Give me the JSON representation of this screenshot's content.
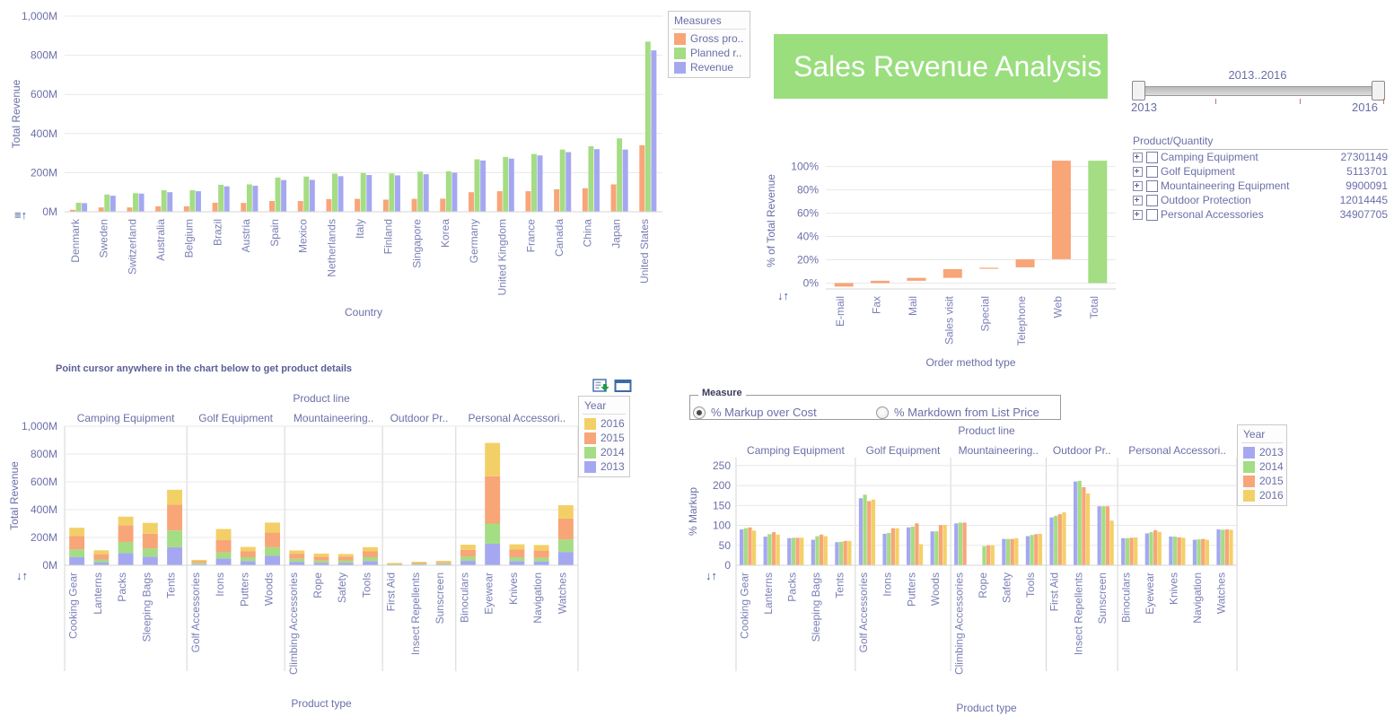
{
  "title_banner": {
    "text": "Sales Revenue Analysis",
    "bg": "#9ade7e",
    "fg": "#ffffff"
  },
  "year_slider": {
    "caption": "2013..2016",
    "min_label": "2013",
    "max_label": "2016"
  },
  "product_quantity": {
    "title": "Product/Quantity",
    "rows": [
      {
        "name": "Camping Equipment",
        "value": "27301149"
      },
      {
        "name": "Golf Equipment",
        "value": "5113701"
      },
      {
        "name": "Mountaineering Equipment",
        "value": "9900091"
      },
      {
        "name": "Outdoor Protection",
        "value": "12014445"
      },
      {
        "name": "Personal Accessories",
        "value": "34907705"
      }
    ]
  },
  "hint": {
    "text": "Point cursor anywhere in the chart below to get product details"
  },
  "measure": {
    "legend": "Measure",
    "options": [
      {
        "label": "% Markup over Cost",
        "selected": true
      },
      {
        "label": "% Markdown from List Price",
        "selected": false
      }
    ]
  },
  "toolbar": {
    "export_icon": "export-icon",
    "window_icon": "window-icon",
    "sort_icon": "sort-icon"
  },
  "colors": {
    "orange": "#f8a578",
    "green": "#a4dd83",
    "purple": "#a5a8f0",
    "yellow": "#f3d067",
    "axis_text": "#6b6fa8",
    "grid": "#e8e8e8"
  },
  "chart_data": [
    {
      "id": "revenue-by-country",
      "type": "bar",
      "title": "",
      "xlabel": "Country",
      "ylabel": "Total Revenue",
      "ylim": [
        0,
        1000
      ],
      "yticks": [
        "0M",
        "200M",
        "400M",
        "600M",
        "800M",
        "1,000M"
      ],
      "legend_title": "Measures",
      "legend_position": "top-right",
      "grid": true,
      "categories": [
        "Denmark",
        "Sweden",
        "Switzerland",
        "Australia",
        "Belgium",
        "Brazil",
        "Austria",
        "Spain",
        "Mexico",
        "Netherlands",
        "Italy",
        "Finland",
        "Singapore",
        "Korea",
        "Germany",
        "United Kingdom",
        "France",
        "Canada",
        "China",
        "Japan",
        "United States"
      ],
      "series": [
        {
          "name": "Gross pro..",
          "color": "#f8a578",
          "values": [
            10,
            22,
            22,
            28,
            28,
            46,
            45,
            55,
            55,
            65,
            66,
            62,
            66,
            67,
            100,
            105,
            105,
            115,
            120,
            140,
            340
          ]
        },
        {
          "name": "Planned r..",
          "color": "#a4dd83",
          "values": [
            46,
            88,
            95,
            110,
            110,
            138,
            140,
            175,
            180,
            195,
            198,
            196,
            205,
            207,
            268,
            280,
            295,
            318,
            335,
            375,
            870
          ]
        },
        {
          "name": "Revenue",
          "color": "#a5a8f0",
          "values": [
            44,
            82,
            93,
            100,
            105,
            130,
            133,
            162,
            163,
            182,
            188,
            186,
            192,
            200,
            262,
            272,
            288,
            305,
            320,
            318,
            825
          ]
        }
      ]
    },
    {
      "id": "revenue-by-order-method",
      "type": "bar",
      "subtype": "waterfall",
      "title": "",
      "xlabel": "Order method type",
      "ylabel": "% of Total Revenue",
      "ylim": [
        -5,
        108
      ],
      "yticks": [
        "0%",
        "20%",
        "40%",
        "60%",
        "80%",
        "100%"
      ],
      "grid": true,
      "categories": [
        "E-mail",
        "Fax",
        "Mail",
        "Sales visit",
        "Special",
        "Telephone",
        "Web",
        "Total"
      ],
      "bars": [
        {
          "category": "E-mail",
          "base": -3.0,
          "top": 0.0,
          "color": "#f8a578"
        },
        {
          "category": "Fax",
          "base": 0.0,
          "top": 2.0,
          "color": "#f8a578"
        },
        {
          "category": "Mail",
          "base": 2.0,
          "top": 4.5,
          "color": "#f8a578"
        },
        {
          "category": "Sales visit",
          "base": 4.5,
          "top": 12.0,
          "color": "#f8a578"
        },
        {
          "category": "Special",
          "base": 12.0,
          "top": 13.5,
          "color": "#f8c9a8"
        },
        {
          "category": "Telephone",
          "base": 13.5,
          "top": 20.5,
          "color": "#f8a578"
        },
        {
          "category": "Web",
          "base": 20.5,
          "top": 105.0,
          "color": "#f8a578"
        },
        {
          "category": "Total",
          "base": 0.0,
          "top": 105.0,
          "color": "#a4dd83"
        }
      ]
    },
    {
      "id": "revenue-by-product-type",
      "type": "bar",
      "subtype": "stacked",
      "title": "",
      "xlabel": "Product type",
      "ylabel": "Total Revenue",
      "group_axis_label": "Product line",
      "ylim": [
        0,
        1000
      ],
      "yticks": [
        "0M",
        "200M",
        "400M",
        "600M",
        "800M",
        "1,000M"
      ],
      "legend_title": "Year",
      "grid": true,
      "groups": [
        {
          "label": "Camping Equipment",
          "types": [
            "Cooking Gear",
            "Lanterns",
            "Packs",
            "Sleeping Bags",
            "Tents"
          ]
        },
        {
          "label": "Golf Equipment",
          "types": [
            "Golf Accessories",
            "Irons",
            "Putters",
            "Woods"
          ]
        },
        {
          "label": "Mountaineering..",
          "types": [
            "Climbing Accessories",
            "Rope",
            "Safety",
            "Tools"
          ]
        },
        {
          "label": "Outdoor Pr..",
          "types": [
            "First Aid",
            "Insect Repellents",
            "Sunscreen"
          ]
        },
        {
          "label": "Personal Accessori..",
          "types": [
            "Binoculars",
            "Eyewear",
            "Knives",
            "Navigation",
            "Watches"
          ]
        }
      ],
      "categories": [
        "Cooking Gear",
        "Lanterns",
        "Packs",
        "Sleeping Bags",
        "Tents",
        "Golf Accessories",
        "Irons",
        "Putters",
        "Woods",
        "Climbing Accessories",
        "Rope",
        "Safety",
        "Tools",
        "First Aid",
        "Insect Repellents",
        "Sunscreen",
        "Binoculars",
        "Eyewear",
        "Knives",
        "Navigation",
        "Watches"
      ],
      "series": [
        {
          "name": "2013",
          "color": "#a5a8f0",
          "values": [
            60,
            22,
            88,
            62,
            130,
            8,
            48,
            30,
            68,
            25,
            18,
            18,
            30,
            4,
            6,
            8,
            32,
            155,
            30,
            28,
            96
          ]
        },
        {
          "name": "2014",
          "color": "#a4dd83",
          "values": [
            55,
            20,
            80,
            60,
            120,
            9,
            45,
            28,
            62,
            22,
            16,
            17,
            28,
            4,
            6,
            7,
            30,
            145,
            28,
            26,
            90
          ]
        },
        {
          "name": "2015",
          "color": "#f8a578",
          "values": [
            95,
            38,
            120,
            105,
            185,
            12,
            90,
            42,
            105,
            36,
            28,
            26,
            42,
            5,
            7,
            9,
            48,
            340,
            55,
            52,
            150
          ]
        },
        {
          "name": "2016",
          "color": "#f3d067",
          "values": [
            60,
            28,
            62,
            78,
            108,
            10,
            78,
            32,
            72,
            24,
            22,
            20,
            30,
            4,
            6,
            8,
            38,
            240,
            38,
            40,
            96
          ]
        }
      ]
    },
    {
      "id": "markup-by-product-type",
      "type": "bar",
      "subtype": "grouped",
      "title": "",
      "xlabel": "Product type",
      "ylabel": "% Markup",
      "group_axis_label": "Product line",
      "ylim": [
        0,
        270
      ],
      "yticks": [
        "0",
        "50",
        "100",
        "150",
        "200",
        "250"
      ],
      "legend_title": "Year",
      "grid": true,
      "groups": [
        {
          "label": "Camping Equipment",
          "types": [
            "Cooking Gear",
            "Lanterns",
            "Packs",
            "Sleeping Bags",
            "Tents"
          ]
        },
        {
          "label": "Golf Equipment",
          "types": [
            "Golf Accessories",
            "Irons",
            "Putters",
            "Woods"
          ]
        },
        {
          "label": "Mountaineering..",
          "types": [
            "Climbing Accessories",
            "Rope",
            "Safety",
            "Tools"
          ]
        },
        {
          "label": "Outdoor Pr..",
          "types": [
            "First Aid",
            "Insect Repellents",
            "Sunscreen"
          ]
        },
        {
          "label": "Personal Accessori..",
          "types": [
            "Binoculars",
            "Eyewear",
            "Knives",
            "Navigation",
            "Watches"
          ]
        }
      ],
      "categories": [
        "Cooking Gear",
        "Lanterns",
        "Packs",
        "Sleeping Bags",
        "Tents",
        "Golf Accessories",
        "Irons",
        "Putters",
        "Woods",
        "Climbing Accessories",
        "Rope",
        "Safety",
        "Tools",
        "First Aid",
        "Insect Repellents",
        "Sunscreen",
        "Binoculars",
        "Eyewear",
        "Knives",
        "Navigation",
        "Watches"
      ],
      "series": [
        {
          "name": "2013",
          "color": "#a5a8f0",
          "values": [
            90,
            72,
            68,
            64,
            58,
            168,
            79,
            95,
            85,
            105,
            0,
            66,
            73,
            120,
            210,
            148,
            68,
            80,
            72,
            64,
            90
          ]
        },
        {
          "name": "2014",
          "color": "#a4dd83",
          "values": [
            93,
            78,
            69,
            73,
            59,
            177,
            81,
            97,
            85,
            107,
            48,
            66,
            76,
            124,
            212,
            148,
            68,
            83,
            72,
            65,
            89
          ]
        },
        {
          "name": "2015",
          "color": "#f8a578",
          "values": [
            95,
            83,
            69,
            77,
            61,
            161,
            93,
            105,
            101,
            107,
            50,
            66,
            78,
            128,
            196,
            148,
            69,
            88,
            70,
            66,
            90
          ]
        },
        {
          "name": "2016",
          "color": "#f3d067",
          "values": [
            87,
            77,
            69,
            73,
            61,
            165,
            93,
            53,
            101,
            0,
            50,
            68,
            79,
            133,
            180,
            112,
            70,
            84,
            69,
            64,
            89
          ]
        }
      ]
    }
  ]
}
